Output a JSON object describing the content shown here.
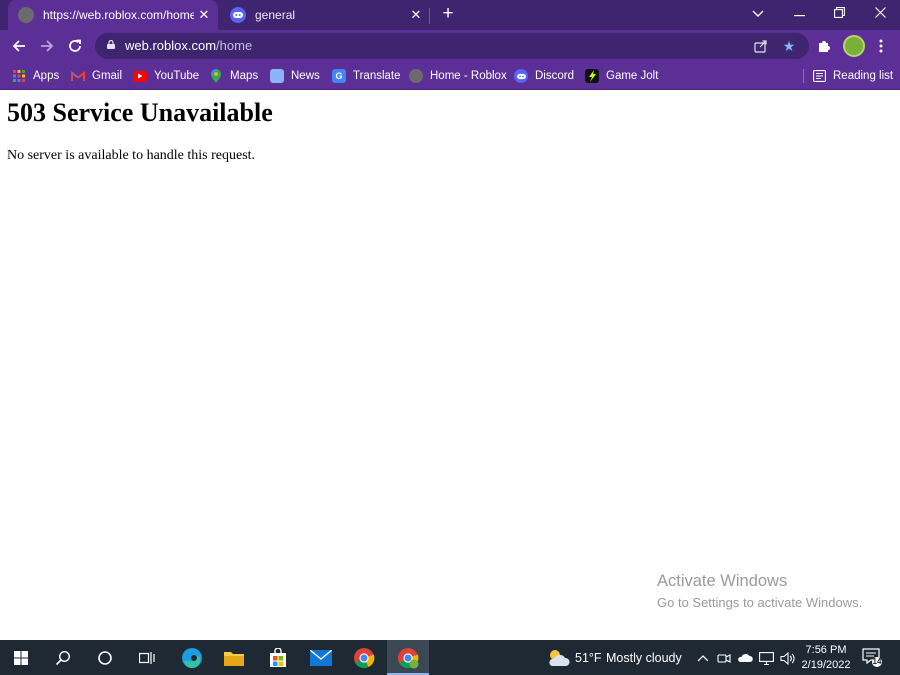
{
  "browser": {
    "tabs": [
      {
        "title": "https://web.roblox.com/home",
        "active": true
      },
      {
        "title": "general",
        "active": false
      }
    ],
    "address": {
      "host": "web.roblox.com",
      "path": "/home"
    },
    "bookmarks": [
      {
        "label": "Apps",
        "icon": "apps-grid-icon"
      },
      {
        "label": "Gmail",
        "icon": "gmail-icon"
      },
      {
        "label": "YouTube",
        "icon": "youtube-icon"
      },
      {
        "label": "Maps",
        "icon": "maps-icon"
      },
      {
        "label": "News",
        "icon": "news-icon"
      },
      {
        "label": "Translate",
        "icon": "translate-icon"
      },
      {
        "label": "Home - Roblox",
        "icon": "roblox-icon"
      },
      {
        "label": "Discord",
        "icon": "discord-icon"
      },
      {
        "label": "Game Jolt",
        "icon": "gamejolt-icon"
      }
    ],
    "reading_list": "Reading list",
    "colors": {
      "frame": "#3f2470",
      "toolbar": "#5b2f95"
    }
  },
  "page": {
    "heading": "503 Service Unavailable",
    "message": "No server is available to handle this request."
  },
  "watermark": {
    "title": "Activate Windows",
    "subtitle": "Go to Settings to activate Windows."
  },
  "taskbar": {
    "weather": {
      "temp": "51°F",
      "condition": "Mostly cloudy"
    },
    "clock": {
      "time": "7:56 PM",
      "date": "2/19/2022"
    },
    "notification_count": "14"
  }
}
